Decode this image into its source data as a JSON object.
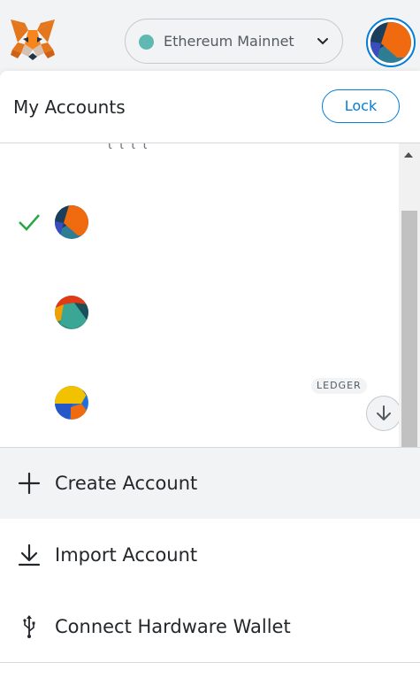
{
  "header": {
    "network": {
      "label": "Ethereum Mainnet",
      "status_color": "#5fb8b2"
    },
    "logo_icon": "metamask-fox-icon"
  },
  "account_menu": {
    "title": "My Accounts",
    "lock_label": "Lock",
    "cut_off_text": "ι ι ι ι",
    "accounts": [
      {
        "selected": true,
        "identicon": "identicon-blue-orange",
        "badge": ""
      },
      {
        "selected": false,
        "identicon": "identicon-red-teal",
        "badge": ""
      },
      {
        "selected": false,
        "identicon": "identicon-yellow-blue",
        "badge": "LEDGER"
      }
    ],
    "actions": [
      {
        "label": "Create Account",
        "icon": "plus-icon"
      },
      {
        "label": "Import Account",
        "icon": "download-icon"
      },
      {
        "label": "Connect Hardware Wallet",
        "icon": "usb-icon"
      }
    ]
  },
  "colors": {
    "accent": "#037dd6",
    "check": "#28a745",
    "background": "#f2f3f4"
  }
}
